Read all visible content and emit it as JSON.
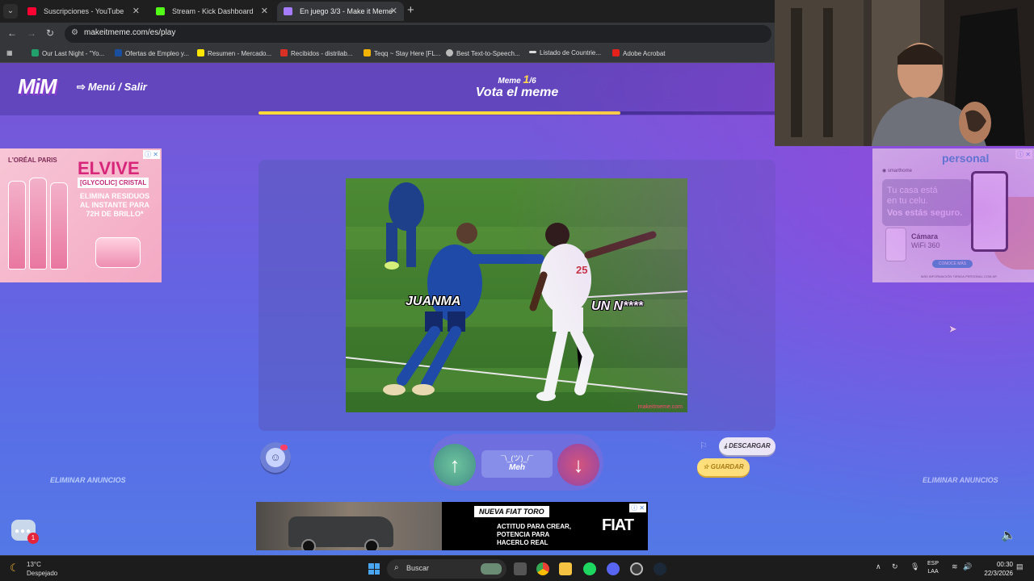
{
  "browser": {
    "tabs": [
      {
        "title": "Suscripciones - YouTube",
        "color": "#ff0033"
      },
      {
        "title": "Stream - Kick Dashboard",
        "color": "#53fc18"
      },
      {
        "title": "En juego 3/3 - Make it Meme",
        "color": "#a57bff"
      }
    ],
    "url": "makeitmeme.com/es/play",
    "bookmarks": [
      {
        "label": "Our Last Night - \"Yo...",
        "color": "#22a06b"
      },
      {
        "label": "Ofertas de Empleo y...",
        "color": "#1a4fa0"
      },
      {
        "label": "Resumen - Mercado...",
        "color": "#ffe600"
      },
      {
        "label": "Recibidos - distrilab...",
        "color": "#d93025"
      },
      {
        "label": "Teqq ~ Stay Here [FL...",
        "color": "#f4b400"
      },
      {
        "label": "Best Text-to-Speech...",
        "color": "#bbbbbb"
      },
      {
        "label": "Listado de Countrie...",
        "color": "#dddddd"
      },
      {
        "label": "Adobe Acrobat",
        "color": "#e5211b"
      }
    ]
  },
  "game": {
    "logo": "MiM",
    "menu_label": "Menú / Salir",
    "meme_prefix": "Meme",
    "meme_current": "1",
    "meme_total": "/6",
    "title": "Vota el meme",
    "progress": 0.7,
    "captions": [
      "JUANMA",
      "UN N****"
    ],
    "watermark": "makeitmeme.com",
    "meh_shrug": "¯\\_(ツ)_/¯",
    "meh_label": "Meh",
    "download_label": "DESCARGAR",
    "save_label": "GUARDAR",
    "remove_ads": "ELIMINAR ANUNCIOS",
    "chat_badge": "1"
  },
  "ads": {
    "left": {
      "brand": "L'ORÉAL PARIS",
      "product": "ELVIVE",
      "badge": "[GLYCOLIC] CRISTAL",
      "claim": "ELIMINA RESIDUOS AL INSTANTE PARA 72H DE BRILLO*"
    },
    "right": {
      "brand": "personal",
      "tag": "smarthome",
      "line1a": "Tu casa está",
      "line1b": "en tu celu.",
      "line2": "Vos estás seguro.",
      "cam_title": "Cámara",
      "cam_sub": "WiFi 360",
      "cta": "CONOCÉ MÁS",
      "fine": "MÁS INFORMACIÓN TIENDA.PERSONAL.COM.AR"
    },
    "bottom": {
      "tag": "NUEVA FIAT TORO",
      "line1": "ACTITUD PARA CREAR,",
      "line2": "POTENCIA PARA",
      "line3": "HACERLO REAL",
      "brand": "FIAT"
    }
  },
  "taskbar": {
    "temp": "13°C",
    "weather": "Despejado",
    "search": "Buscar",
    "lang1": "ESP",
    "lang2": "LAA",
    "time": "00:30",
    "date": "22/3/2026"
  }
}
